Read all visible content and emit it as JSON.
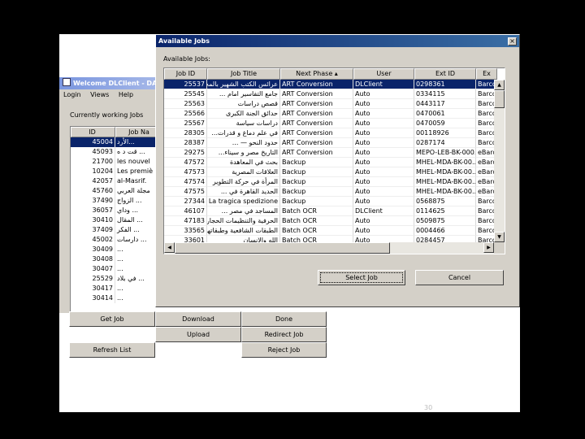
{
  "client": {
    "title": "Welcome DLClient - DAF",
    "menu": [
      "Login",
      "Views",
      "Help"
    ],
    "currently_label": "Currently working Jobs",
    "columns": [
      "ID",
      "Job Na"
    ],
    "rows": [
      {
        "id": "45004",
        "name": "الأرد...",
        "selected": true
      },
      {
        "id": "45093",
        "name": "قت د ه ..."
      },
      {
        "id": "21700",
        "name": "les nouvel"
      },
      {
        "id": "10204",
        "name": "Les premiè"
      },
      {
        "id": "42057",
        "name": "al-Masrif."
      },
      {
        "id": "45760",
        "name": "مجلة العربي"
      },
      {
        "id": "37490",
        "name": "الزواج ..."
      },
      {
        "id": "36057",
        "name": "وداي ..."
      },
      {
        "id": "30410",
        "name": "المقال ..."
      },
      {
        "id": "37409",
        "name": "الفكر ..."
      },
      {
        "id": "45002",
        "name": "دارسات ..."
      },
      {
        "id": "30409",
        "name": "..."
      },
      {
        "id": "30408",
        "name": "..."
      },
      {
        "id": "30407",
        "name": "..."
      },
      {
        "id": "25529",
        "name": "في بلاد ..."
      },
      {
        "id": "30417",
        "name": "..."
      },
      {
        "id": "30414",
        "name": "..."
      }
    ],
    "buttons": {
      "get_job": "Get Job",
      "download": "Download",
      "done": "Done",
      "upload": "Upload",
      "redirect_job": "Redirect Job",
      "refresh_list": "Refresh List",
      "reject_job": "Reject Job"
    }
  },
  "dialog": {
    "title": "Available Jobs",
    "close": "×",
    "label": "Available Jobs:",
    "columns": [
      "Job ID",
      "Job Title",
      "Next Phase",
      "User",
      "Ext ID",
      "Ex"
    ],
    "rows": [
      {
        "id": "25537",
        "title": "عرائس الكتب الشهير بالمختار",
        "phase": "ART Conversion",
        "user": "DLClient",
        "ext": "0298361",
        "ex": "Barco",
        "selected": true
      },
      {
        "id": "25545",
        "title": "جامع التفاسير امام ...",
        "phase": "ART Conversion",
        "user": "Auto",
        "ext": "0334115",
        "ex": "Barco"
      },
      {
        "id": "25563",
        "title": "قصص دراسات",
        "phase": "ART Conversion",
        "user": "Auto",
        "ext": "0443117",
        "ex": "Barco"
      },
      {
        "id": "25566",
        "title": "حدائق الجنة الكبرى",
        "phase": "ART Conversion",
        "user": "Auto",
        "ext": "0470061",
        "ex": "Barco"
      },
      {
        "id": "25567",
        "title": "دراسات سياسة",
        "phase": "ART Conversion",
        "user": "Auto",
        "ext": "0470059",
        "ex": "Barco"
      },
      {
        "id": "28305",
        "title": "في علم دماغ و قدرات...",
        "phase": "ART Conversion",
        "user": "Auto",
        "ext": "00118926",
        "ex": "Barco"
      },
      {
        "id": "28387",
        "title": "حدود النحو — ...",
        "phase": "ART Conversion",
        "user": "Auto",
        "ext": "0287174",
        "ex": "Barco"
      },
      {
        "id": "29275",
        "title": "التاريخ مصر و سيناء...",
        "phase": "ART Conversion",
        "user": "Auto",
        "ext": "MEPO-LEB-BK-000...",
        "ex": "eBarco"
      },
      {
        "id": "47572",
        "title": "بحث في المعاهدة",
        "phase": "Backup",
        "user": "Auto",
        "ext": "MHEL-MDA-BK-00...",
        "ex": "eBarco"
      },
      {
        "id": "47573",
        "title": "العلاقات المصرية",
        "phase": "Backup",
        "user": "Auto",
        "ext": "MHEL-MDA-BK-00...",
        "ex": "eBarco"
      },
      {
        "id": "47574",
        "title": "المرأة في حركة التطوير",
        "phase": "Backup",
        "user": "Auto",
        "ext": "MHEL-MDA-BK-00...",
        "ex": "eBarco"
      },
      {
        "id": "47575",
        "title": "الحديد القاهرة في ...",
        "phase": "Backup",
        "user": "Auto",
        "ext": "MHEL-MDA-BK-00...",
        "ex": "eBarco"
      },
      {
        "id": "27344",
        "title": "La tragica spedizione ...",
        "phase": "Backup",
        "user": "Auto",
        "ext": "0568875",
        "ex": "Barco"
      },
      {
        "id": "46107",
        "title": "المساجد في مصر ...",
        "phase": "Batch OCR",
        "user": "DLClient",
        "ext": "0114625",
        "ex": "Barco"
      },
      {
        "id": "47183",
        "title": "الحرفية والتنظيمات الحجارية",
        "phase": "Batch OCR",
        "user": "Auto",
        "ext": "0509875",
        "ex": "Barco"
      },
      {
        "id": "33565",
        "title": "الطبقات الشافعية وطبقاتهم",
        "phase": "Batch OCR",
        "user": "Auto",
        "ext": "0004466",
        "ex": "Barco"
      },
      {
        "id": "33601",
        "title": "الله والانسان",
        "phase": "Batch OCR",
        "user": "Auto",
        "ext": "0284457",
        "ex": "Barco"
      }
    ],
    "select_button": "Select Job",
    "cancel_button": "Cancel"
  },
  "slide_number": "30"
}
